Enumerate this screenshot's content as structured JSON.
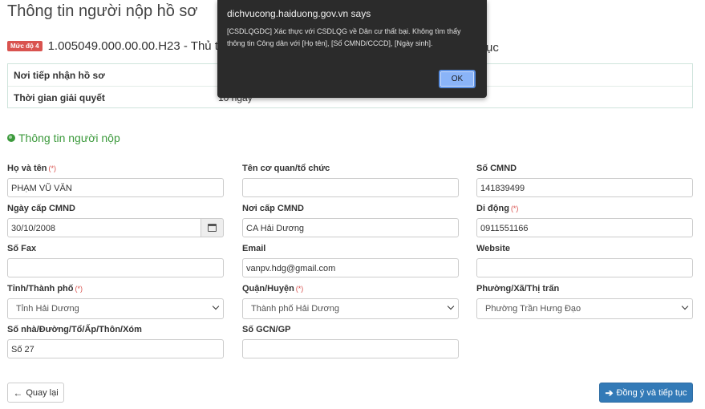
{
  "page": {
    "title": "Thông tin người nộp hồ sơ"
  },
  "procedure": {
    "level_badge": "Mức độ 4",
    "code_text": "1.005049.000.00.00.H23 - Thủ tục",
    "text_tail": "ục"
  },
  "info": [
    {
      "label": "Nơi tiếp nhận hồ sơ",
      "value": ""
    },
    {
      "label": "Thời gian giải quyết",
      "value": "10 ngày"
    }
  ],
  "section": {
    "title": "Thông tin người nộp"
  },
  "form": {
    "ho_ten": {
      "label": "Họ và tên",
      "required_mark": "(*)",
      "value": "PHẠM VŨ VĂN"
    },
    "ten_co_quan": {
      "label": "Tên cơ quan/tổ chức",
      "value": ""
    },
    "so_cmnd": {
      "label": "Số CMND",
      "value": "141839499"
    },
    "ngay_cap": {
      "label": "Ngày cấp CMND",
      "value": "30/10/2008"
    },
    "noi_cap": {
      "label": "Nơi cấp CMND",
      "value": "CA Hải Dương"
    },
    "di_dong": {
      "label": "Di động",
      "required_mark": "(*)",
      "value": "0911551166"
    },
    "so_fax": {
      "label": "Số Fax",
      "value": ""
    },
    "email": {
      "label": "Email",
      "value": "vanpv.hdg@gmail.com"
    },
    "website": {
      "label": "Website",
      "value": ""
    },
    "tinh": {
      "label": "Tỉnh/Thành phố",
      "required_mark": "(*)",
      "value": "Tỉnh Hải Dương"
    },
    "quan": {
      "label": "Quận/Huyện",
      "required_mark": "(*)",
      "value": "Thành phố Hải Dương"
    },
    "phuong": {
      "label": "Phường/Xã/Thị trấn",
      "value": "Phường Trần Hưng Đạo"
    },
    "so_nha": {
      "label": "Số nhà/Đường/Tổ/Ấp/Thôn/Xóm",
      "value": "Số 27"
    },
    "so_gcn": {
      "label": "Số GCN/GP",
      "value": ""
    }
  },
  "buttons": {
    "back": "Quay lại",
    "next": "Đồng ý và tiếp tục"
  },
  "dialog": {
    "title": "dichvucong.haiduong.gov.vn says",
    "message": "[CSDLQGDC] Xác thực với CSDLQG về Dân cư thất bại. Không tìm thấy thông tin Công dân với [Họ tên], [Số CMND/CCCD], [Ngày sinh].",
    "ok": "OK"
  },
  "icons": {
    "section": "globe-icon",
    "date": "calendar-icon",
    "back": "arrow-left-icon",
    "next": "arrow-right-icon"
  },
  "colors": {
    "accent_green": "#3c9a3c",
    "primary_blue": "#337ab7",
    "required_red": "#d9534f",
    "dialog_bg": "#2b2b2b"
  }
}
